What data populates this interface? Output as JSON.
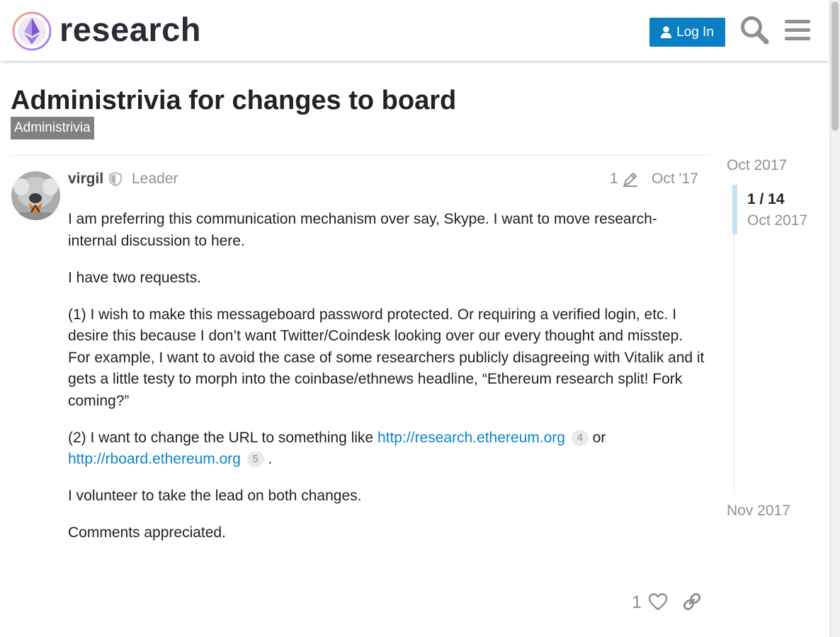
{
  "header": {
    "logo_text": "research",
    "login_label": "Log In",
    "search_icon": "search-icon",
    "menu_icon": "hamburger-menu-icon",
    "accent_color": "#0a7fc4"
  },
  "topic": {
    "title": "Administrivia for changes to board",
    "category": "Administrivia",
    "category_color": "#808281"
  },
  "post": {
    "username": "virgil",
    "user_title": "Leader",
    "edit_count": "1",
    "date": "Oct '17",
    "paragraphs": {
      "p1": "I am preferring this communication mechanism over say, Skype. I want to move research-internal discussion to here.",
      "p2": "I have two requests.",
      "p3": "(1) I wish to make this messageboard password protected. Or requiring a verified login, etc. I desire this because I don’t want Twitter/Coindesk looking over our every thought and misstep. For example, I want to avoid the case of some researchers publicly disagreeing with Vitalik and it gets a little testy to morph into the coinbase/ethnews headline, “Ethereum research split! Fork coming?”",
      "p4_prefix": "(2) I want to change the URL to something like ",
      "p4_link1": "http://research.ethereum.org",
      "p4_link1_clicks": "4",
      "p4_or": " or ",
      "p4_link2": "http://rboard.ethereum.org",
      "p4_link2_clicks": "5",
      "p4_suffix": " .",
      "p5": "I volunteer to take the lead on both changes.",
      "p6": "Comments appreciated."
    },
    "like_count": "1"
  },
  "timeline": {
    "start_date": "Oct 2017",
    "counter": "1 / 14",
    "current_date": "Oct 2017",
    "end_date": "Nov 2017"
  }
}
